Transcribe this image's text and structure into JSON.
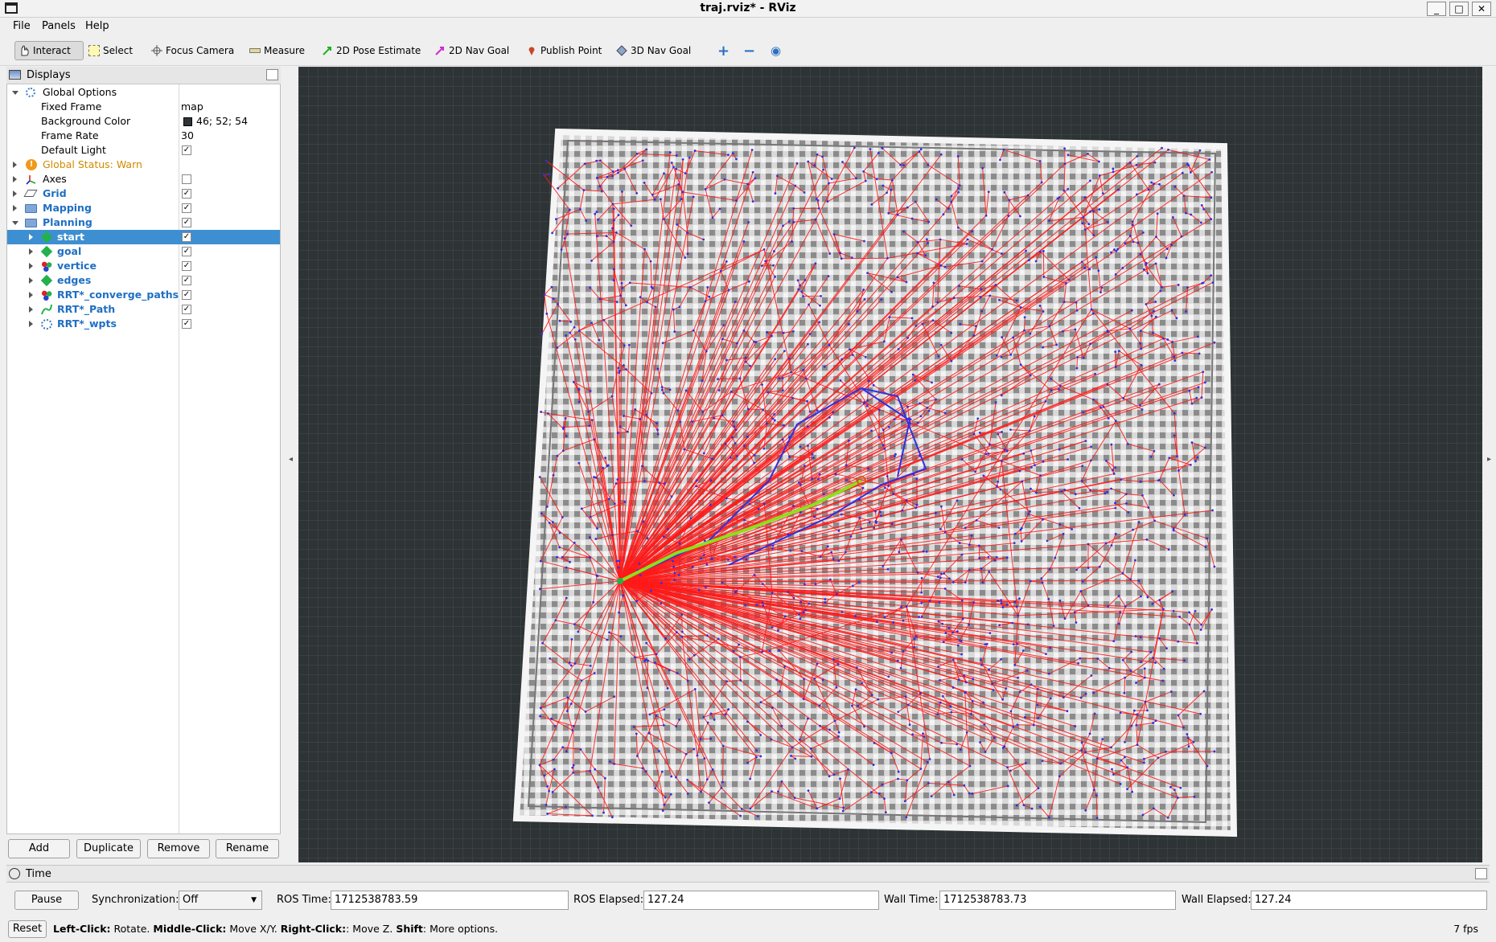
{
  "window": {
    "title": "traj.rviz* - RViz",
    "min": "_",
    "max": "□",
    "close": "✕"
  },
  "menu": [
    {
      "label": "File"
    },
    {
      "label": "Panels"
    },
    {
      "label": "Help"
    }
  ],
  "toolbar": {
    "interact": "Interact",
    "select": "Select",
    "focus_camera": "Focus Camera",
    "measure": "Measure",
    "pose_estimate": "2D Pose Estimate",
    "nav_goal_2d": "2D Nav Goal",
    "publish_point": "Publish Point",
    "nav_goal_3d": "3D Nav Goal"
  },
  "displays": {
    "title": "Displays",
    "global_options": "Global Options",
    "fixed_frame_label": "Fixed Frame",
    "fixed_frame_value": "map",
    "bg_color_label": "Background Color",
    "bg_color_value": "46; 52; 54",
    "bg_color_hex": "#2e3436",
    "frame_rate_label": "Frame Rate",
    "frame_rate_value": "30",
    "default_light_label": "Default Light",
    "global_status": "Global Status: Warn",
    "axes": "Axes",
    "grid": "Grid",
    "mapping": "Mapping",
    "planning": "Planning",
    "children": [
      "start",
      "goal",
      "vertice",
      "edges",
      "RRT*_converge_paths",
      "RRT*_Path",
      "RRT*_wpts"
    ]
  },
  "buttons": {
    "add": "Add",
    "duplicate": "Duplicate",
    "remove": "Remove",
    "rename": "Rename"
  },
  "time": {
    "title": "Time",
    "pause": "Pause",
    "sync_label": "Synchronization:",
    "sync_value": "Off",
    "ros_time_label": "ROS Time:",
    "ros_time": "1712538783.59",
    "ros_elapsed_label": "ROS Elapsed:",
    "ros_elapsed": "127.24",
    "wall_time_label": "Wall Time:",
    "wall_time": "1712538783.73",
    "wall_elapsed_label": "Wall Elapsed:",
    "wall_elapsed": "127.24"
  },
  "status": {
    "reset": "Reset",
    "left_click": "Left-Click:",
    "left_desc": " Rotate. ",
    "middle_click": "Middle-Click:",
    "middle_desc": " Move X/Y. ",
    "right_click": "Right-Click:",
    "right_desc": ": Move Z. ",
    "shift": "Shift",
    "shift_desc": ": More options.",
    "fps": "7 fps"
  },
  "colors": {
    "edges": "#ff1a1a",
    "vertices": "#3030e0",
    "path": "#8ee01a",
    "selection": "#3d8fd1"
  }
}
